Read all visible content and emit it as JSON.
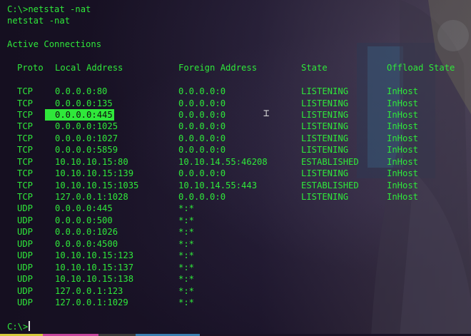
{
  "terminal": {
    "command_line": "C:\\>netstat -nat",
    "echo_line": "netstat -nat",
    "section_title": "Active Connections",
    "columns": [
      "Proto",
      "Local Address",
      "Foreign Address",
      "State",
      "Offload State"
    ],
    "rows": [
      [
        "TCP",
        "0.0.0.0:80",
        "0.0.0.0:0",
        "LISTENING",
        "InHost"
      ],
      [
        "TCP",
        "0.0.0.0:135",
        "0.0.0.0:0",
        "LISTENING",
        "InHost"
      ],
      [
        "TCP",
        "0.0.0.0:445",
        "0.0.0.0:0",
        "LISTENING",
        "InHost"
      ],
      [
        "TCP",
        "0.0.0.0:1025",
        "0.0.0.0:0",
        "LISTENING",
        "InHost"
      ],
      [
        "TCP",
        "0.0.0.0:1027",
        "0.0.0.0:0",
        "LISTENING",
        "InHost"
      ],
      [
        "TCP",
        "0.0.0.0:5859",
        "0.0.0.0:0",
        "LISTENING",
        "InHost"
      ],
      [
        "TCP",
        "10.10.10.15:80",
        "10.10.14.55:46208",
        "ESTABLISHED",
        "InHost"
      ],
      [
        "TCP",
        "10.10.10.15:139",
        "0.0.0.0:0",
        "LISTENING",
        "InHost"
      ],
      [
        "TCP",
        "10.10.10.15:1035",
        "10.10.14.55:443",
        "ESTABLISHED",
        "InHost"
      ],
      [
        "TCP",
        "127.0.0.1:1028",
        "0.0.0.0:0",
        "LISTENING",
        "InHost"
      ],
      [
        "UDP",
        "0.0.0.0:445",
        "*:*",
        "",
        ""
      ],
      [
        "UDP",
        "0.0.0.0:500",
        "*:*",
        "",
        ""
      ],
      [
        "UDP",
        "0.0.0.0:1026",
        "*:*",
        "",
        ""
      ],
      [
        "UDP",
        "0.0.0.0:4500",
        "*:*",
        "",
        ""
      ],
      [
        "UDP",
        "10.10.10.15:123",
        "*:*",
        "",
        ""
      ],
      [
        "UDP",
        "10.10.10.15:137",
        "*:*",
        "",
        ""
      ],
      [
        "UDP",
        "10.10.10.15:138",
        "*:*",
        "",
        ""
      ],
      [
        "UDP",
        "127.0.0.1:123",
        "*:*",
        "",
        ""
      ],
      [
        "UDP",
        "127.0.0.1:1029",
        "*:*",
        "",
        ""
      ]
    ],
    "highlighted_row_index": 2,
    "prompt": "C:\\>",
    "text_color": "#2fe83a",
    "highlight_color": "#2fe83a"
  },
  "taskbar": {
    "segments": [
      {
        "color": "#d4c93a"
      },
      {
        "color": "#c8479e"
      },
      {
        "color": "#3c3c3c"
      },
      {
        "color": "#3a7fb0"
      },
      {
        "color": "#1a1326"
      }
    ]
  },
  "icons": {
    "cursor": "text-cursor-icon"
  }
}
